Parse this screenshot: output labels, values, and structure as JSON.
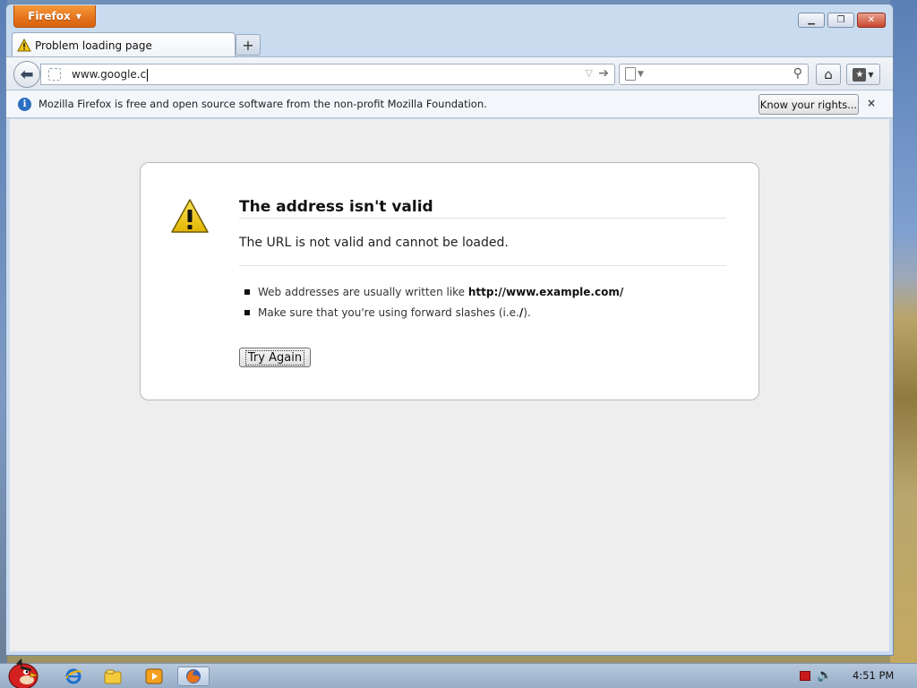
{
  "app": {
    "menu_button_label": "Firefox"
  },
  "tab": {
    "title": "Problem loading page"
  },
  "navbar": {
    "url_value": "www.google.c",
    "search_placeholder": ""
  },
  "notification": {
    "text": "Mozilla Firefox is free and open source software from the non-profit Mozilla Foundation.",
    "button_label": "Know your rights...",
    "close_glyph": "×"
  },
  "error_page": {
    "title": "The address isn't valid",
    "short_desc": "The URL is not valid and cannot be loaded.",
    "tips": [
      {
        "prefix": "Web addresses are usually written like ",
        "bold": "http://www.example.com/",
        "suffix": ""
      },
      {
        "prefix": "Make sure that you're using forward slashes (i.e. ",
        "bold": "/",
        "suffix": ")."
      }
    ],
    "button_label": "Try Again"
  },
  "taskbar": {
    "clock": "4:51 PM"
  },
  "colors": {
    "firefox_orange": "#e4721c",
    "info_blue": "#2a6fc1",
    "warning_yellow": "#f2c811",
    "content_bg": "#eeeeee"
  },
  "icons": [
    "warning-icon",
    "back-arrow-icon",
    "home-icon",
    "bookmarks-icon",
    "search-icon",
    "info-icon",
    "close-icon",
    "new-tab-icon"
  ]
}
